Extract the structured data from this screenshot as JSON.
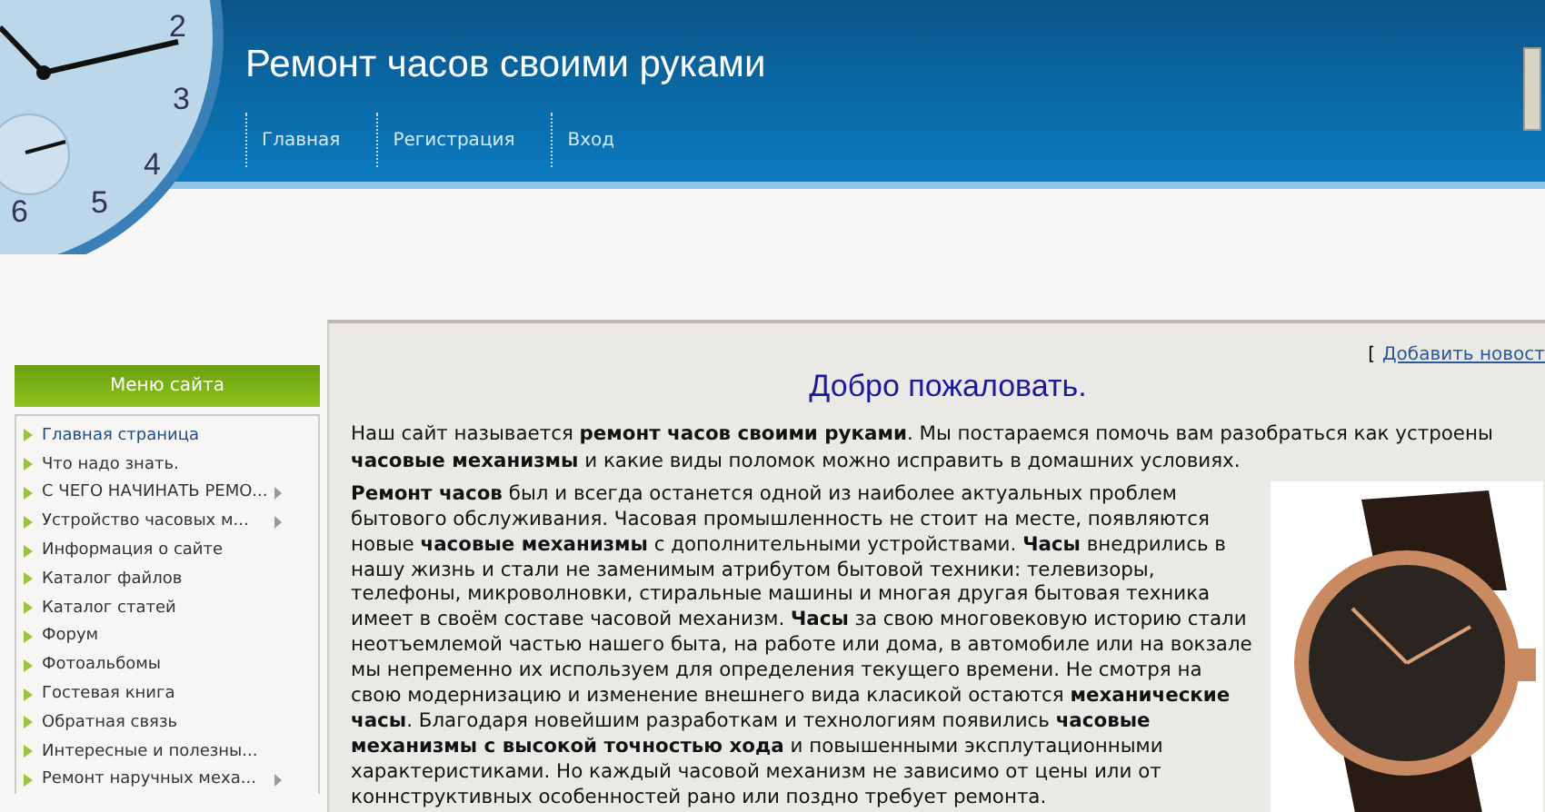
{
  "header": {
    "clock_numbers": [
      "2",
      "3",
      "4",
      "6",
      "5"
    ],
    "title": "Ремонт часов своими руками",
    "nav": [
      {
        "label": "Главная"
      },
      {
        "label": "Регистрация"
      },
      {
        "label": "Вход"
      }
    ]
  },
  "sidebar": {
    "title": "Меню сайта",
    "items": [
      {
        "label": "Главная страница",
        "selected": true,
        "has_submenu": false
      },
      {
        "label": "Что надо знать.",
        "selected": false,
        "has_submenu": false
      },
      {
        "label": "С ЧЕГО НАЧИНАТЬ РЕМО...",
        "selected": false,
        "has_submenu": true
      },
      {
        "label": "Устройство часовых м...",
        "selected": false,
        "has_submenu": true
      },
      {
        "label": "Информация о сайте",
        "selected": false,
        "has_submenu": false
      },
      {
        "label": "Каталог файлов",
        "selected": false,
        "has_submenu": false
      },
      {
        "label": "Каталог статей",
        "selected": false,
        "has_submenu": false
      },
      {
        "label": "Форум",
        "selected": false,
        "has_submenu": false
      },
      {
        "label": "Фотоальбомы",
        "selected": false,
        "has_submenu": false
      },
      {
        "label": "Гостевая книга",
        "selected": false,
        "has_submenu": false
      },
      {
        "label": "Обратная связь",
        "selected": false,
        "has_submenu": false
      },
      {
        "label": "Интересные и полезны...",
        "selected": false,
        "has_submenu": false
      },
      {
        "label": "Ремонт наручных меха...",
        "selected": false,
        "has_submenu": true
      }
    ]
  },
  "content": {
    "bracket": "[",
    "add_news_link": "Добавить новост",
    "heading": "Добро пожаловать.",
    "intro": "Наш сайт называется **ремонт часов своими руками**. Мы постараемся помочь вам разобраться как устроены **часовые механизмы** и какие виды поломок можно исправить в домашних условиях.",
    "body": "**Ремонт часов** был и всегда останется одной из наиболее актуальных проблем бытового обслуживания. Часовая промышленность не стоит на месте, появляются новые **часовые механизмы** с дополнительными устройствами. **Часы** внедрились в нашу жизнь и стали не заменимым атрибутом бытовой техники: телевизоры, телефоны, микроволновки, стиральные машины и многая другая бытовая техника имеет в своём составе часовой механизм. **Часы** за свою многовековую историю стали неотъемлемой частью нашего быта, на работе или дома, в автомобиле или на вокзале мы непременно их используем для определения текущего времени. Не смотря на свою модернизацию и изменение внешнего вида класикой остаются **механические часы**. Благодаря новейшим разработкам и технологиям появились **часовые механизмы с высокой точностью хода** и повышенными эксплутационными характеристиками. Но каждый часовой механизм не зависимо от цены или от коннструктивных особенностей рано или поздно требует ремонта."
  }
}
